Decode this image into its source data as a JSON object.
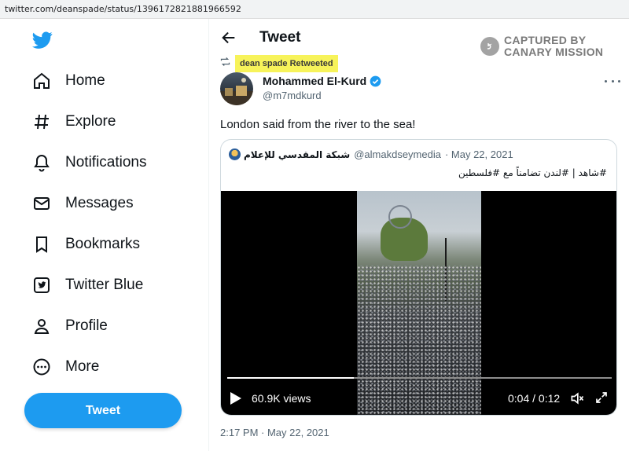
{
  "browser": {
    "url": "twitter.com/deanspade/status/1396172821881966592"
  },
  "sidebar": {
    "logo_icon": "twitter-bird-icon",
    "items": [
      {
        "label": "Home",
        "icon": "home-icon"
      },
      {
        "label": "Explore",
        "icon": "hashtag-icon"
      },
      {
        "label": "Notifications",
        "icon": "bell-icon"
      },
      {
        "label": "Messages",
        "icon": "envelope-icon"
      },
      {
        "label": "Bookmarks",
        "icon": "bookmark-icon"
      },
      {
        "label": "Twitter Blue",
        "icon": "twitter-blue-icon"
      },
      {
        "label": "Profile",
        "icon": "person-icon"
      },
      {
        "label": "More",
        "icon": "more-circle-icon"
      }
    ],
    "tweet_button": "Tweet"
  },
  "header": {
    "title": "Tweet",
    "back_icon": "arrow-left-icon"
  },
  "watermark": {
    "line1": "CAPTURED BY",
    "line2": "CANARY MISSION"
  },
  "tweet": {
    "retweet_label": "dean spade Retweeted",
    "author": {
      "name": "Mohammed El-Kurd",
      "handle": "@m7mdkurd",
      "verified": true
    },
    "text": "London said from the river to the sea!",
    "timestamp": "2:17 PM · May 22, 2021"
  },
  "quote": {
    "name": "شبكة المقدسي للإعلام",
    "handle": "@almakdseymedia",
    "date": "· May 22, 2021",
    "text": "#شاهد | #لندن تضامناً مع #فلسطين",
    "video": {
      "views": "60.9K views",
      "time": "0:04 / 0:12",
      "progress": 0.33
    }
  },
  "colors": {
    "accent": "#1d9bf0",
    "highlight": "#f7f35a",
    "text": "#0f1419",
    "muted": "#536471"
  }
}
